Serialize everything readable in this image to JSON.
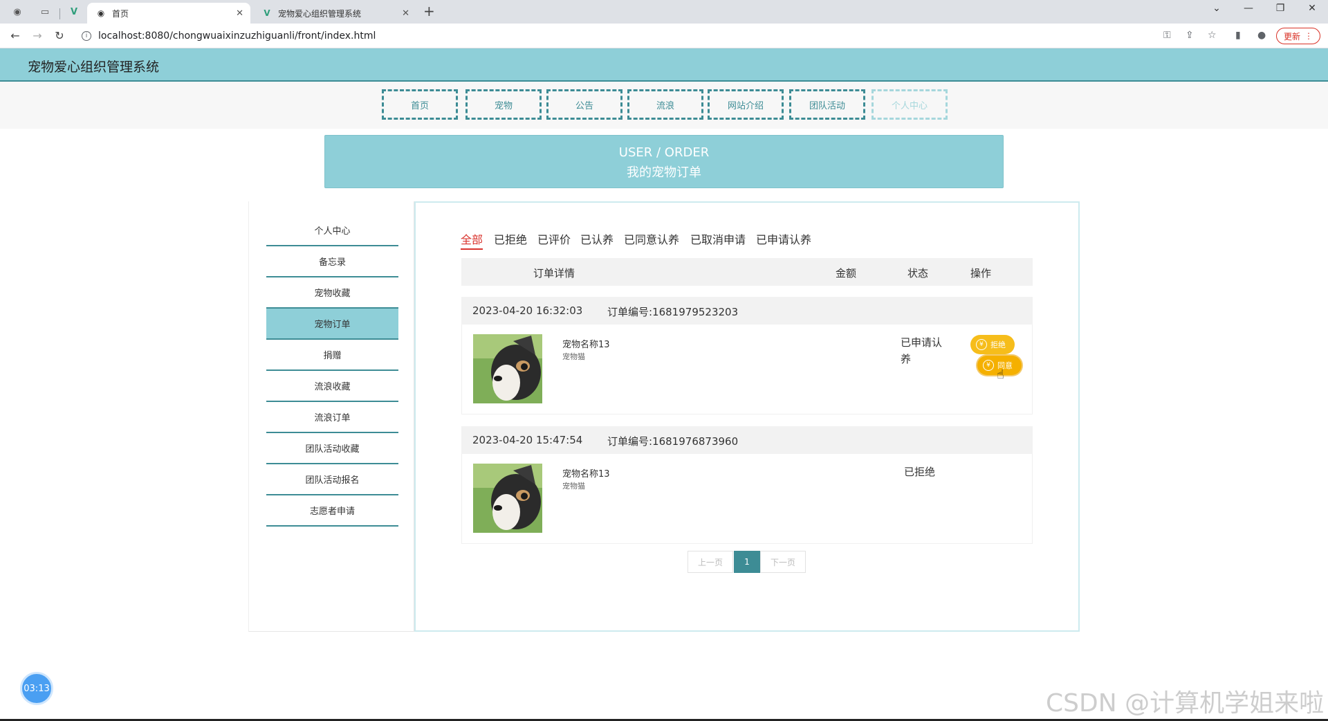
{
  "browser": {
    "tabs": [
      {
        "title": "首页",
        "active": true
      },
      {
        "title": "宠物爱心组织管理系统",
        "active": false
      }
    ],
    "url": "localhost:8080/chongwuaixinzuzhiguanli/front/index.html",
    "update_label": "更新"
  },
  "site": {
    "title": "宠物爱心组织管理系统",
    "nav": [
      "首页",
      "宠物",
      "公告",
      "流浪",
      "网站介绍",
      "团队活动",
      "个人中心"
    ]
  },
  "banner": {
    "line1": "USER / ORDER",
    "line2": "我的宠物订单"
  },
  "sidebar": {
    "items": [
      "个人中心",
      "备忘录",
      "宠物收藏",
      "宠物订单",
      "捐赠",
      "流浪收藏",
      "流浪订单",
      "团队活动收藏",
      "团队活动报名",
      "志愿者申请"
    ],
    "active_index": 3
  },
  "filters": {
    "tabs": [
      "全部",
      "已拒绝",
      "已评价",
      "已认养",
      "已同意认养",
      "已取消申请",
      "已申请认养"
    ],
    "active_index": 0
  },
  "table": {
    "headers": {
      "detail": "订单详情",
      "amount": "金额",
      "status": "状态",
      "action": "操作"
    }
  },
  "orders": [
    {
      "time": "2023-04-20 16:32:03",
      "order_no": "订单编号:1681979523203",
      "pet_name": "宠物名称13",
      "pet_type": "宠物猫",
      "status_line1": "已申请认",
      "status_line2": "养",
      "buttons": {
        "reject": "拒绝",
        "agree": "同意"
      }
    },
    {
      "time": "2023-04-20 15:47:54",
      "order_no": "订单编号:1681976873960",
      "pet_name": "宠物名称13",
      "pet_type": "宠物猫",
      "status_line1": "已拒绝"
    }
  ],
  "pagination": {
    "prev": "上一页",
    "current": "1",
    "next": "下一页"
  },
  "timer": "03:13",
  "watermark": "CSDN @计算机学姐来啦",
  "colors": {
    "teal": "#3d8c95",
    "header_bg": "#8ecfd8",
    "active_filter": "#d9332d",
    "button_yellow": "#f6bd1b"
  }
}
